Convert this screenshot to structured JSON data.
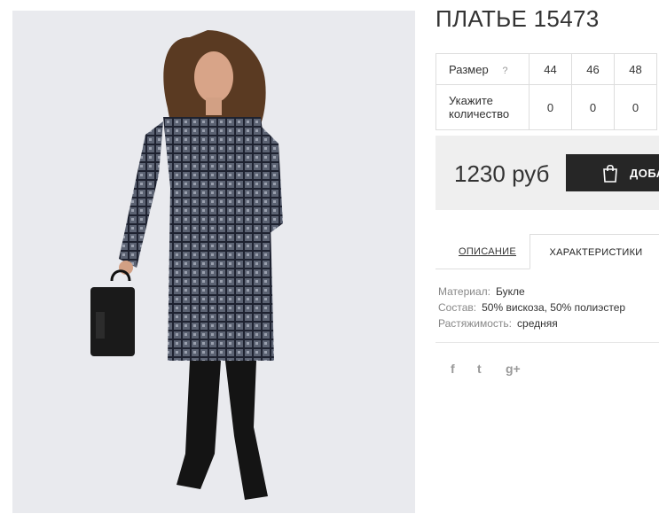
{
  "product": {
    "title": "ПЛАТЬЕ 15473"
  },
  "size_table": {
    "size_label": "Размер",
    "help_icon": "?",
    "sizes": [
      "44",
      "46",
      "48"
    ],
    "quantity_label": "Укажите количество",
    "quantities": [
      "0",
      "0",
      "0"
    ]
  },
  "purchase": {
    "price": "1230 руб",
    "add_button_label": "ДОБА"
  },
  "tabs": [
    {
      "label": "ОПИСАНИЕ",
      "active": false
    },
    {
      "label": "ХАРАКТЕРИСТИКИ",
      "active": true
    }
  ],
  "characteristics": [
    {
      "key": "Материал:",
      "value": "Букле"
    },
    {
      "key": "Состав:",
      "value": "50% вискоза, 50% полиэстер"
    },
    {
      "key": "Растяжимость:",
      "value": "средняя"
    }
  ],
  "social": {
    "icons": [
      "facebook-icon",
      "twitter-icon",
      "google-plus-icon"
    ],
    "facebook": "f",
    "twitter": "t",
    "google_plus": "g+"
  },
  "colors": {
    "photo_bg": "#e9eaee",
    "button_bg": "#262626",
    "price_bg": "#efefef"
  }
}
